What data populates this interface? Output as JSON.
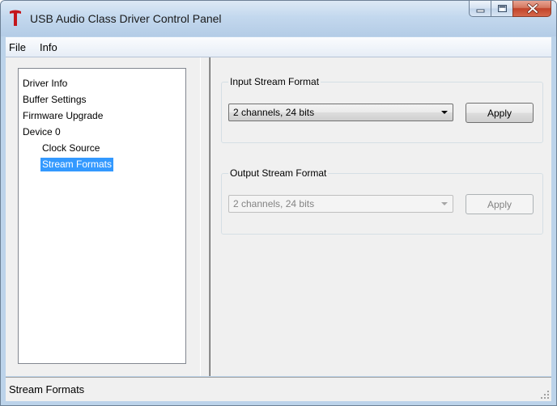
{
  "window": {
    "title": "USB Audio Class Driver Control Panel",
    "logo_color": "#c4161c",
    "accent_selection": "#3399ff"
  },
  "menu": {
    "items": [
      "File",
      "Info"
    ]
  },
  "tree": {
    "items": [
      {
        "label": "Driver Info",
        "level": 0,
        "selected": false
      },
      {
        "label": "Buffer Settings",
        "level": 0,
        "selected": false
      },
      {
        "label": "Firmware Upgrade",
        "level": 0,
        "selected": false
      },
      {
        "label": "Device 0",
        "level": 0,
        "selected": false
      },
      {
        "label": "Clock Source",
        "level": 1,
        "selected": false
      },
      {
        "label": "Stream Formats",
        "level": 1,
        "selected": true
      }
    ]
  },
  "input_stream": {
    "title": "Input Stream Format",
    "selected_value": "2 channels, 24 bits",
    "apply_label": "Apply",
    "enabled": true
  },
  "output_stream": {
    "title": "Output Stream Format",
    "selected_value": "2 channels, 24 bits",
    "apply_label": "Apply",
    "enabled": false
  },
  "status": {
    "text": "Stream Formats"
  },
  "icons": {
    "logo": "t-logo-icon",
    "minimize": "minimize-icon",
    "maximize": "maximize-icon",
    "close": "close-icon",
    "dropdown": "chevron-down-icon",
    "resize_grip": "resize-grip-icon"
  }
}
